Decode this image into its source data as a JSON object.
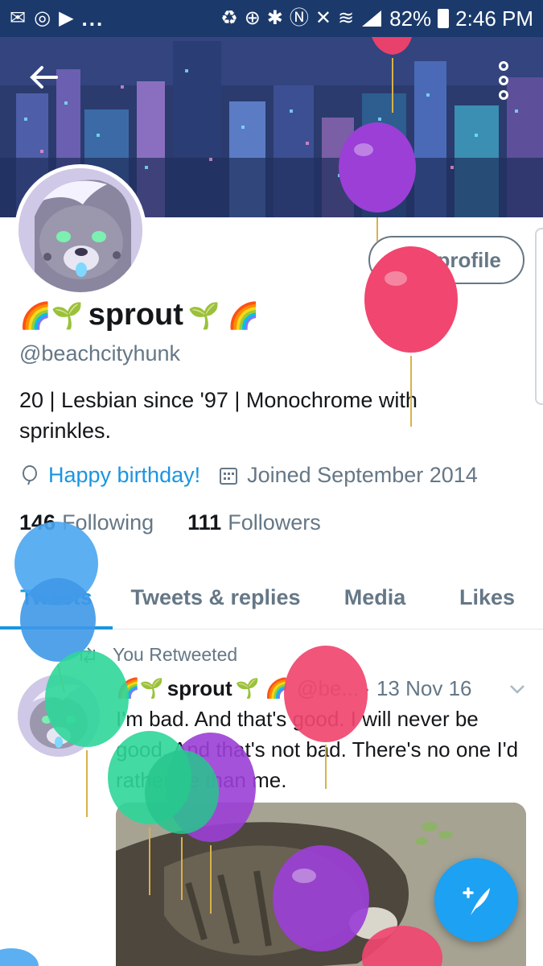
{
  "status_bar": {
    "battery": "82%",
    "time": "2:46 PM",
    "ellipsis": "..."
  },
  "profile": {
    "name": "sprout",
    "name_emoji_left": "🌈🌱",
    "name_emoji_right": "🌱 🌈",
    "handle": "@beachcityhunk",
    "bio": "20 | Lesbian since '97 | Monochrome with sprinkles.",
    "birthday_label": "Happy birthday!",
    "joined": "Joined September 2014",
    "following_count": "146",
    "following_label": "Following",
    "followers_count": "111",
    "followers_label": "Followers",
    "edit_profile_label": "Edit profile"
  },
  "tabs": [
    {
      "label": "Tweets",
      "active": true
    },
    {
      "label": "Tweets & replies",
      "active": false
    },
    {
      "label": "Media",
      "active": false
    },
    {
      "label": "Likes",
      "active": false
    }
  ],
  "tweet": {
    "retweet_label": "You Retweeted",
    "author_name": "sprout",
    "author_emoji_left": "🌈🌱",
    "author_emoji_right": "🌱 🌈",
    "author_handle": "@be...",
    "date": "· 13 Nov 16",
    "text": "I'm bad. And that's good. I will never be good. And that's not bad. There's no one I'd rather be than me."
  },
  "colors": {
    "accent": "#1b95e0",
    "secondary_text": "#657786",
    "status_bar": "#1b3a6b",
    "fab": "#1da1f2"
  },
  "icons": {
    "back": "arrow-left-icon",
    "overflow": "vertical-dots-icon",
    "birthday": "balloon-icon",
    "calendar": "calendar-icon",
    "retweet": "retweet-icon",
    "chevron": "chevron-down-icon",
    "compose": "compose-tweet-icon"
  }
}
